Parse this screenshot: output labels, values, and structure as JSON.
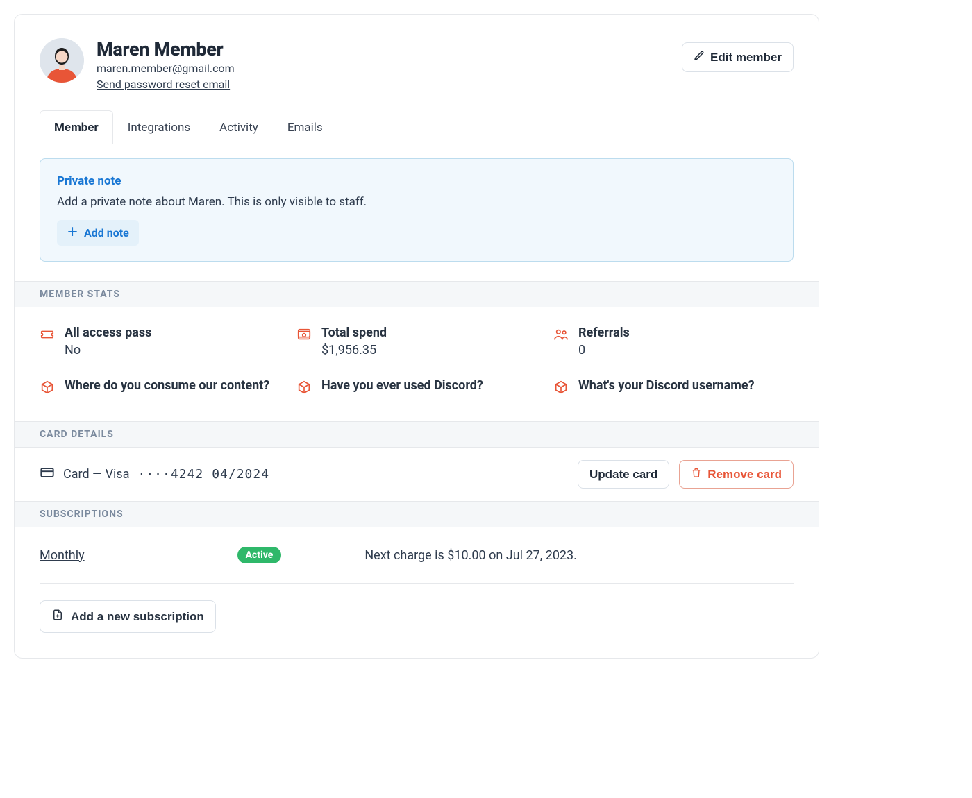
{
  "member": {
    "name": "Maren Member",
    "email": "maren.member@gmail.com",
    "reset_link": "Send password reset email"
  },
  "actions": {
    "edit_member": "Edit member"
  },
  "tabs": {
    "member": "Member",
    "integrations": "Integrations",
    "activity": "Activity",
    "emails": "Emails"
  },
  "note": {
    "title": "Private note",
    "description": "Add a private note about Maren. This is only visible to staff.",
    "add": "Add note"
  },
  "sections": {
    "stats": "MEMBER STATS",
    "card": "CARD DETAILS",
    "subs": "SUBSCRIPTIONS"
  },
  "stats": {
    "all_access_label": "All access pass",
    "all_access_value": "No",
    "total_spend_label": "Total spend",
    "total_spend_value": "$1,956.35",
    "referrals_label": "Referrals",
    "referrals_value": "0",
    "q1_label": "Where do you consume our content?",
    "q2_label": "Have you ever used Discord?",
    "q3_label": "What's your Discord username?"
  },
  "card": {
    "text": "Card — Visa",
    "masked": "····4242",
    "expiry": "04/2024",
    "update": "Update card",
    "remove": "Remove card"
  },
  "subscriptions": {
    "name": "Monthly",
    "status": "Active",
    "next_charge": "Next charge is $10.00 on  Jul 27, 2023.",
    "add": "Add a new subscription"
  }
}
